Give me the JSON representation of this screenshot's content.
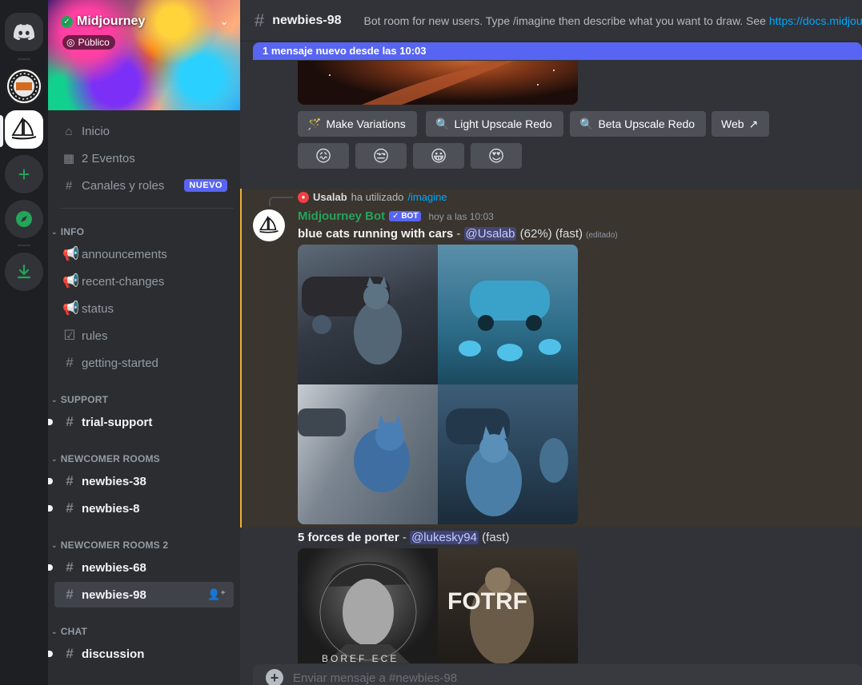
{
  "server": {
    "name": "Midjourney",
    "visibility": "Público"
  },
  "nav": {
    "home": "Inicio",
    "events": "2 Eventos",
    "channels_roles": "Canales y roles",
    "new_badge": "NUEVO"
  },
  "categories": {
    "info": "INFO",
    "support": "SUPPORT",
    "newcomer": "NEWCOMER ROOMS",
    "newcomer2": "NEWCOMER ROOMS 2",
    "chat": "CHAT"
  },
  "channels": {
    "announcements": "announcements",
    "recent_changes": "recent-changes",
    "status": "status",
    "rules": "rules",
    "getting_started": "getting-started",
    "trial_support": "trial-support",
    "newbies_38": "newbies-38",
    "newbies_8": "newbies-8",
    "newbies_68": "newbies-68",
    "newbies_98": "newbies-98",
    "discussion": "discussion"
  },
  "header": {
    "channel": "newbies-98",
    "topic": "Bot room for new users. Type /imagine then describe what you want to draw. See ",
    "link": "https://docs.midjourney.com"
  },
  "new_messages_bar": "1 mensaje nuevo desde las 10:03",
  "actions": {
    "make_variations": "Make Variations",
    "light_upscale": "Light Upscale Redo",
    "beta_upscale": "Beta Upscale Redo",
    "web": "Web"
  },
  "reactions": [
    "😖",
    "😒",
    "😀",
    "😍"
  ],
  "message1": {
    "reply_user": "Usalab",
    "reply_text": "ha utilizado",
    "reply_command": "/imagine",
    "author": "Midjourney Bot",
    "bot_badge": "✓ BOT",
    "time": "hoy a las 10:03",
    "prompt": "blue cats running with cars",
    "dash": " - ",
    "mention": "@Usalab",
    "status": " (62%) (fast) ",
    "edited": "(editado)"
  },
  "message2": {
    "prompt": "5 forces de porter",
    "dash": " - ",
    "mention": "@lukesky94",
    "status": " (fast)",
    "poster_text": "FOTRF",
    "poster_caption": "BOREF ECE"
  },
  "composer": {
    "placeholder": "Enviar mensaje a #newbies-98"
  },
  "colors": {
    "accent": "#5865f2",
    "bot_name": "#23a55a",
    "highlight_border": "#f0b232",
    "link": "#00a8fc"
  }
}
